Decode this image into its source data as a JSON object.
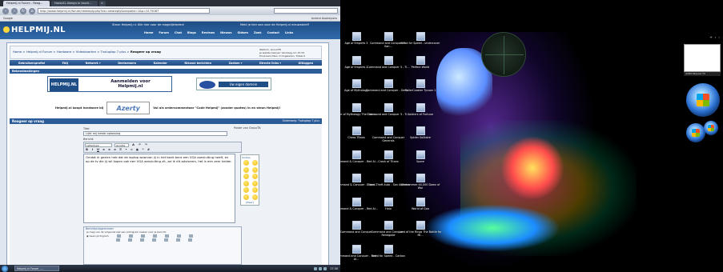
{
  "browser": {
    "tabs": [
      "Helpmij.nl Forum - Reag...",
      "HostuXL Always in touch...",
      "×"
    ],
    "url": "http://www.helpmij.nl/forum/newreply.php?do=newreply&noquote=1&p=3175087",
    "bookmarks": [
      "Google",
      "Andere bladwijzers"
    ]
  },
  "site": {
    "logo": "HELPMIJ.NL",
    "ad_left": "Steun Helpmij.nl. Klik hier voor de mogelijkheden!",
    "ad_right": "Meld je hier aan voor de Helpmij.nl nieuwsbrief!",
    "topmenu": [
      "Home",
      "Forum",
      "Chat",
      "Blogs",
      "Reviews",
      "Nieuws",
      "Gidsen",
      "Zoek",
      "Contact",
      "Links"
    ],
    "breadcrumb": {
      "parts": [
        "Home",
        "Helpmij.nl Forum",
        "Hardware",
        "Videokaarten",
        "Tvaluptop 7 plus"
      ],
      "current": "Reageer op vraag"
    },
    "welcome": [
      "Welkom, GrouxTB",
      "Je laatste bezoek: Vandaag om 15:34",
      "Privé berichten: 0 Ongelezen, Totaal 0"
    ],
    "mainnav": [
      "Gebruikersprofiel",
      "FAQ",
      "Netwerk ▾",
      "Deelnemers",
      "Kalender",
      "Nieuwe berichten",
      "Zoeken ▾",
      "Directe links ▾",
      "Uitloggen"
    ],
    "section_label": "Bekendmakingen",
    "banner1": {
      "logo": "HELPMIJ.NL",
      "text": "Aanmelden voor Helpmij.nl"
    },
    "banner2": {
      "text": "Uw eigen domein"
    },
    "hardware_left": "Helpmij.nl koopt hardware bij",
    "hardware_brand": "Azerty",
    "hardware_right": "Vul als ordercommentaar \"Code Helpmij\" (zonder quotes) in en steun Helpmij!"
  },
  "reply": {
    "header": "Reageer op vraag",
    "header_right": "Onderwerp: Tvaluptop 7 plus",
    "title_label": "Titel:",
    "title_value": "Lijkt mij beste oplossing",
    "post_label": "Bericht:",
    "font_select": "Lettertype",
    "size_select": "Grootte",
    "message": "Omdat ik gezien heb dat de laptop waarvan jij in het bezit bent een VGA aansluiting heeft, en op de tv die jij wil kopen ook een VGA aansluiting zit, zal ik dit adviseren, het is een zeer helder.",
    "smilies_header": "Smilies",
    "smilies_more": "[Meer]",
    "icons_header": "Berichtpictogrammen",
    "icons_text": "Je mag van de volgende lijst een pictogram kiezen voor je bericht:",
    "icons_none": "Geen pictogram",
    "poster_label": "Poster van GrouxTB"
  },
  "taskbar": {
    "task": "Helpmij.nl Forum - ...",
    "clock": "17:30"
  },
  "desktop": {
    "icons": [
      {
        "label": "Age of Empires 3"
      },
      {
        "label": "Command and Conquer 3 - Kan..."
      },
      {
        "label": "Need for Speed - undercover"
      },
      {
        "label": "Age of Empires 2"
      },
      {
        "label": "Command and Conquer 3 - Ti..."
      },
      {
        "label": "Perfect World"
      },
      {
        "label": "Age of Mythology"
      },
      {
        "label": "Command and Conquer - Gene..."
      },
      {
        "label": "RollerCoaster Tycoon 2"
      },
      {
        "label": "Age of Mythology The Titans"
      },
      {
        "label": "Command and Conquer 3 - Ti..."
      },
      {
        "label": "Soldiers of Fortune"
      },
      {
        "label": "Chess Titans"
      },
      {
        "label": "Command and Conquer Generals"
      },
      {
        "label": "Spider Solitaire"
      },
      {
        "label": "Command & Conquer - Red Al..."
      },
      {
        "label": "Crash of Titans"
      },
      {
        "label": "Spore"
      },
      {
        "label": "Command & Conquer - Tiben..."
      },
      {
        "label": "Grand Theft Auto - San Andreas"
      },
      {
        "label": "Warhammer 40,000 Dawn of War"
      },
      {
        "label": "Command & Conquer - Red Al..."
      },
      {
        "label": "Halo"
      },
      {
        "label": "World of Goo"
      },
      {
        "label": "Command and Conquer"
      },
      {
        "label": "Command and Conquer - Renegade"
      },
      {
        "label": "Lord of the Rings The Battle for Mi..."
      },
      {
        "label": "Command and Conquer - Red Al..."
      },
      {
        "label": "Need for Speed - Carbon"
      }
    ],
    "gadget_label": "AVRO Nieuws TV"
  },
  "colors": {
    "site_blue": "#1f4d86",
    "nav_blue": "#2c5c98",
    "desktop_bg": "#000000"
  }
}
